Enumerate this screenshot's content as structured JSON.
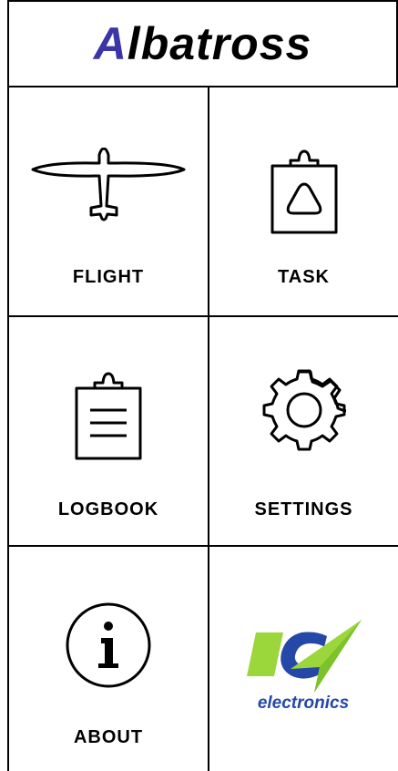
{
  "app": {
    "logo_prefix": "A",
    "logo_rest": "lbatross"
  },
  "menu": {
    "flight": {
      "label": "FLIGHT",
      "icon": "glider-icon"
    },
    "task": {
      "label": "TASK",
      "icon": "clipboard-triangle-icon"
    },
    "logbook": {
      "label": "LOGBOOK",
      "icon": "clipboard-list-icon"
    },
    "settings": {
      "label": "SETTINGS",
      "icon": "gear-icon"
    },
    "about": {
      "label": "ABOUT",
      "icon": "info-icon"
    },
    "partner": {
      "label": "electronics",
      "icon": "rc-electronics-logo"
    }
  },
  "colors": {
    "brand_accent": "#3b35a8",
    "partner_green": "#9bd63a",
    "partner_blue": "#2548a8"
  }
}
